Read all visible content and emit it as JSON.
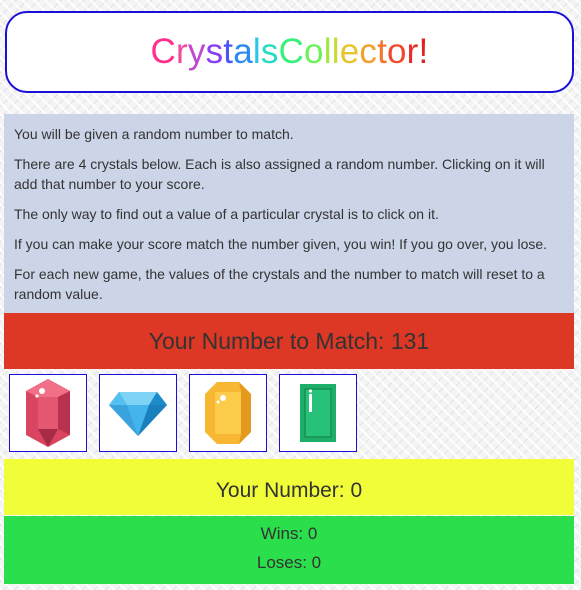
{
  "title": {
    "text": "Crystals Collector!",
    "letter_colors": [
      "#ff2f8c",
      "#f24a9a",
      "#c049cf",
      "#8a3ff0",
      "#4a56f5",
      "#2a8cf0",
      "#27c8e6",
      "#28dcc3",
      "#2ee8a4",
      "#38f07c",
      "#6bf25a",
      "#9fe840",
      "#cadb37",
      "#e6c52f",
      "#f2a12f",
      "#f3762d",
      "#f04a2d",
      "#ea2c2c",
      "#e31f1f"
    ]
  },
  "instructions": [
    "You will be given a random number to match.",
    "There are 4 crystals below. Each is also assigned a random number. Clicking on it will add that number to your score.",
    "The only way to find out a value of a particular crystal is to click on it.",
    "If you can make your score match the number given, you win! If you go over, you lose.",
    "For each new game, the values of the crystals and the number to match will reset to a random value."
  ],
  "target": {
    "label": "Your Number to Match: 131"
  },
  "crystals": [
    {
      "icon": "red-gem-icon",
      "color": "#d94560"
    },
    {
      "icon": "blue-diamond-icon",
      "color": "#2fa9e6"
    },
    {
      "icon": "yellow-gem-icon",
      "color": "#f7b733"
    },
    {
      "icon": "green-emerald-icon",
      "color": "#1fae6a"
    }
  ],
  "score": {
    "label": "Your Number: 0"
  },
  "record": {
    "wins": "Wins: 0",
    "losses": "Loses: 0"
  }
}
